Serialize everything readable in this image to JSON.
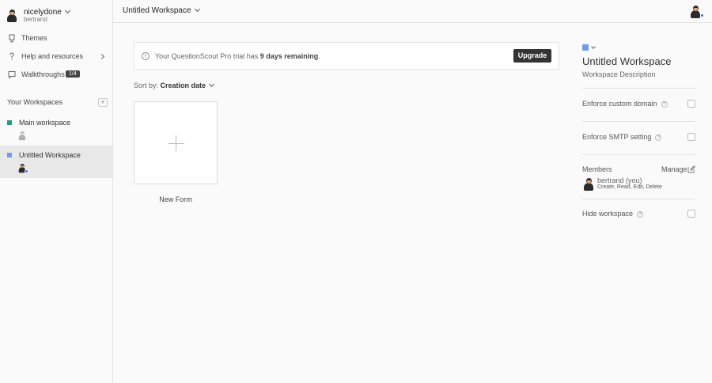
{
  "user": {
    "name": "nicelydone",
    "handle": "bertrand"
  },
  "nav": [
    {
      "label": "Themes",
      "icon": "themes-icon"
    },
    {
      "label": "Help and resources",
      "icon": "help-question-icon"
    },
    {
      "label": "Walkthroughs",
      "icon": "chat-bubble-icon",
      "badge": "1/4"
    }
  ],
  "workspaces": {
    "title": "Your Workspaces",
    "add_label": "+",
    "items": [
      {
        "label": "Main workspace",
        "color": "#1aa085"
      },
      {
        "label": "Untitled Workspace",
        "color": "#6d9ceb"
      }
    ]
  },
  "topbar": {
    "title": "Untitled Workspace"
  },
  "banner": {
    "prefix": "Your QuestionScout Pro trial has",
    "highlight": "9 days remaining",
    "suffix": ".",
    "info_glyph": "!",
    "button": "Upgrade"
  },
  "sort": {
    "label": "Sort by:",
    "value": "Creation date"
  },
  "new_form": {
    "label": "New Form"
  },
  "panel": {
    "title": "Untitled Workspace",
    "description": "Workspace Description",
    "enforce_domain": "Enforce custom domain",
    "enforce_smtp": "Enforce SMTP setting",
    "help_glyph": "?",
    "members_label": "Members",
    "manage": "Manage",
    "member_name": "bertrand (you)",
    "member_perms": "Create, Read, Edit, Delete",
    "hide_workspace": "Hide workspace",
    "accent": "#6d9ceb"
  }
}
